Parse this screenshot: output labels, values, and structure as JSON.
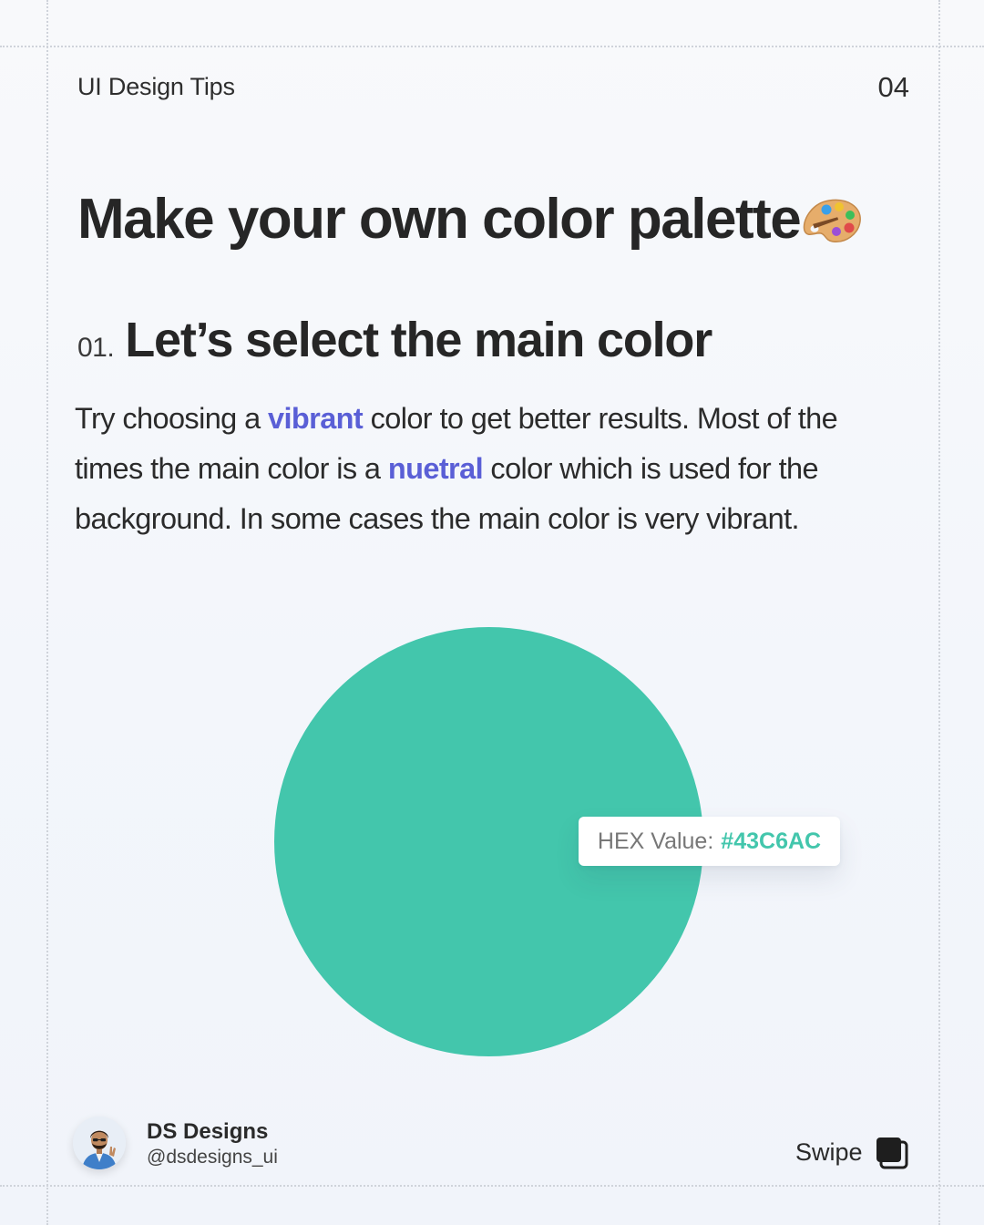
{
  "header": {
    "series_label": "UI Design Tips",
    "page_number": "04"
  },
  "title": {
    "text": "Make your own color palette",
    "emoji_icon": "artist-palette-icon"
  },
  "step": {
    "number": "01.",
    "heading": "Let’s select the main color"
  },
  "body": {
    "part1": "Try choosing a ",
    "highlight1": "vibrant",
    "part2": " color to get better results. Most of the times the main color is a ",
    "highlight2": "nuetral",
    "part3": " color which is used for the background. In some cases the main color is very vibrant."
  },
  "swatch": {
    "color": "#43C6AC",
    "label": "HEX Value:",
    "hex": "#43C6AC"
  },
  "footer": {
    "author_name": "DS Designs",
    "author_handle": "@dsdesigns_ui",
    "swipe_label": "Swipe",
    "swipe_icon": "stacked-pages-icon"
  },
  "colors": {
    "accent_text": "#5A5FD6",
    "main_color": "#43C6AC"
  }
}
